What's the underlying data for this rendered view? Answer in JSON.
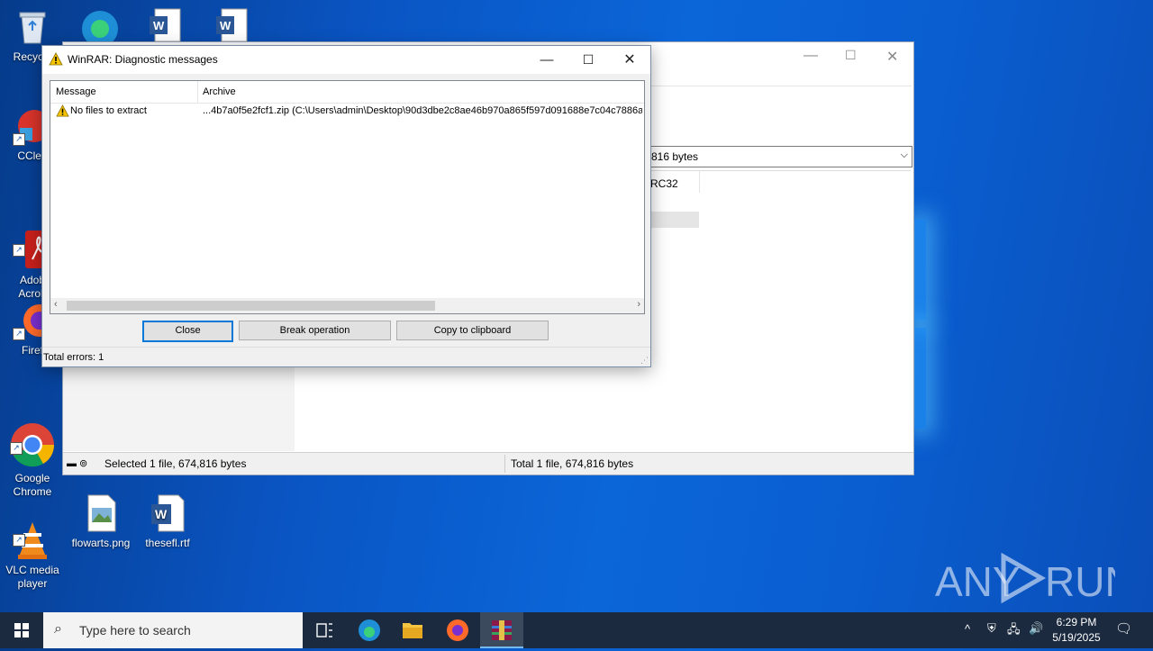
{
  "desktop": {
    "icons": [
      {
        "label": "Recycle",
        "icon": "recycle-bin-icon"
      },
      {
        "label": "CClea",
        "icon": "ccleaner-icon"
      },
      {
        "label": "Adob\nAcrob",
        "icon": "adobe-acrobat-icon"
      },
      {
        "label": "Firef",
        "icon": "firefox-icon"
      },
      {
        "label": "Google\nChrome",
        "icon": "chrome-icon"
      },
      {
        "label": "VLC media\nplayer",
        "icon": "vlc-icon"
      },
      {
        "label": "flowarts.png",
        "icon": "image-file-icon"
      },
      {
        "label": "thesefl.rtf",
        "icon": "word-document-icon"
      }
    ],
    "watermark": "ANY RUN"
  },
  "background_window": {
    "combo_text": "816 bytes",
    "column_header": "RC32",
    "status_left": "Selected 1 file, 674,816 bytes",
    "status_right": "Total 1 file, 674,816 bytes"
  },
  "dialog": {
    "title": "WinRAR: Diagnostic messages",
    "columns": {
      "message": "Message",
      "archive": "Archive"
    },
    "rows": [
      {
        "message": "No files to extract",
        "archive": "...4b7a0f5e2fcf1.zip (C:\\Users\\admin\\Desktop\\90d3dbe2c8ae46b970a865f597d091688e7c04c7886a"
      }
    ],
    "buttons": {
      "close": "Close",
      "break": "Break operation",
      "copy": "Copy to clipboard"
    },
    "status": "Total errors: 1"
  },
  "taskbar": {
    "search_placeholder": "Type here to search",
    "time": "6:29 PM",
    "date": "5/19/2025"
  },
  "colors": {
    "accent": "#0078d7",
    "taskbar": "#1b2a3f",
    "desktop": "#0a5ed0"
  }
}
